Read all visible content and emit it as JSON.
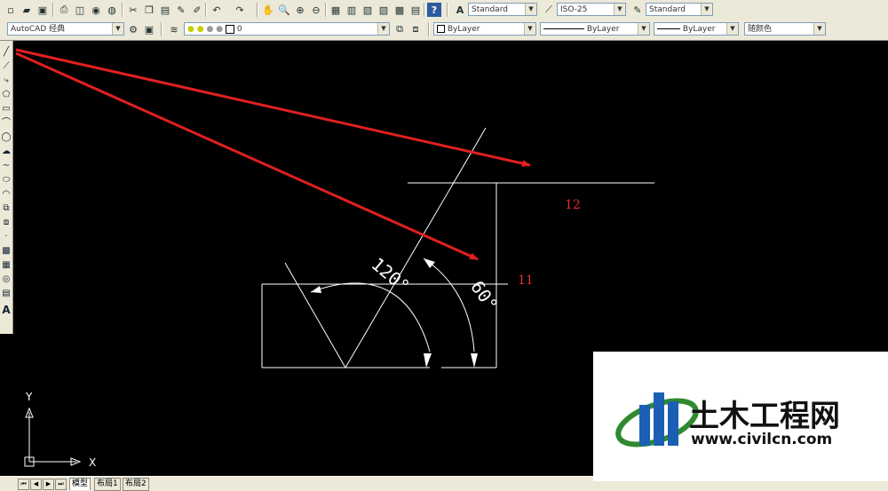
{
  "toolbar1": {
    "text_style": "Standard",
    "dim_style": "ISO-25",
    "table_style": "Standard"
  },
  "toolbar2": {
    "workspace": "AutoCAD 经典",
    "layer": "0",
    "color": "ByLayer",
    "linetype": "ByLayer",
    "lineweight": "ByLayer",
    "plotstyle": "随颜色"
  },
  "drawing": {
    "angle_large": "120°",
    "angle_small": "60°",
    "label_upper": "12",
    "label_lower": "11",
    "line_color": "#ffffff",
    "arrow_color": "#e02020",
    "label_color": "#e03030"
  },
  "ucs": {
    "x_label": "X",
    "y_label": "Y"
  },
  "tabs": [
    "模型",
    "布局1",
    "布局2"
  ],
  "watermark": {
    "title": "土木工程网",
    "url": "www.civilcn.com"
  }
}
